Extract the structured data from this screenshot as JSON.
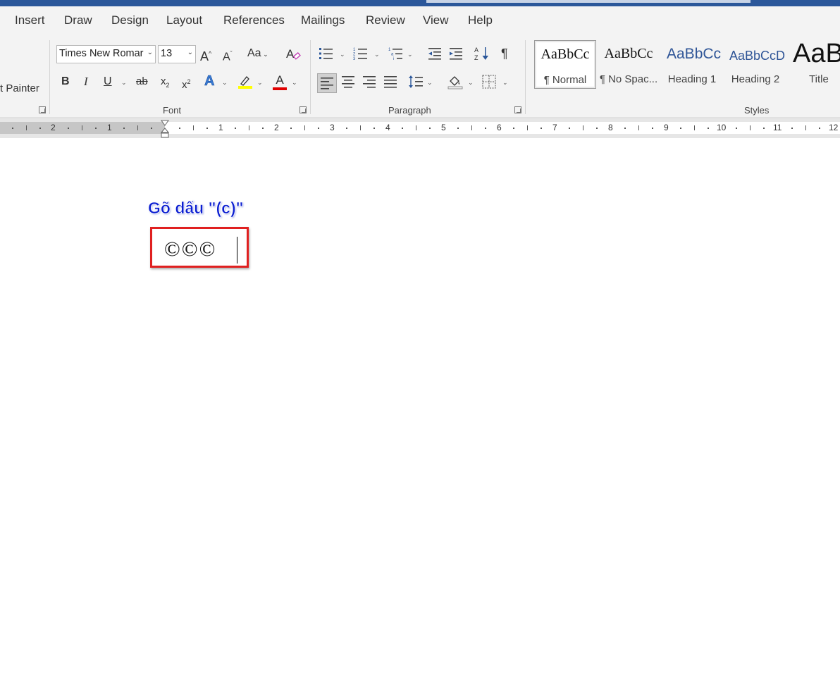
{
  "tabs": [
    "Insert",
    "Draw",
    "Design",
    "Layout",
    "References",
    "Mailings",
    "Review",
    "View",
    "Help"
  ],
  "clipboard": {
    "format_painter_label": "t Painter"
  },
  "font": {
    "name": "Times New Romar",
    "size": "13",
    "group_label": "Font",
    "grow_label": "A",
    "shrink_label": "A",
    "change_case_label": "Aa",
    "bold": "B",
    "italic": "I",
    "underline": "U",
    "strikethrough": "ab",
    "subscript": "x",
    "subscript_digit": "2",
    "superscript": "x",
    "superscript_digit": "2",
    "text_effects": "A",
    "font_color": "A",
    "highlight_color_hex": "#ffff00",
    "font_color_hex": "#e00000"
  },
  "paragraph": {
    "group_label": "Paragraph",
    "show_marks": "¶"
  },
  "styles": {
    "group_label": "Styles",
    "items": [
      {
        "sample": "AaBbCc",
        "name": "¶ Normal"
      },
      {
        "sample": "AaBbCc",
        "name": "¶ No Spac..."
      },
      {
        "sample": "AaBbCc",
        "name": "Heading 1"
      },
      {
        "sample": "AaBbCcD",
        "name": "Heading 2"
      },
      {
        "sample": "AaB",
        "name": "Title"
      }
    ]
  },
  "ruler": {
    "left_numbers": [
      "2",
      "1"
    ],
    "right_numbers": [
      "1",
      "2",
      "3",
      "4",
      "5",
      "6",
      "7",
      "8",
      "9",
      "10",
      "11",
      "12"
    ]
  },
  "document": {
    "annotation": "Gõ dấu \"(c)\"",
    "content": "©©©"
  }
}
